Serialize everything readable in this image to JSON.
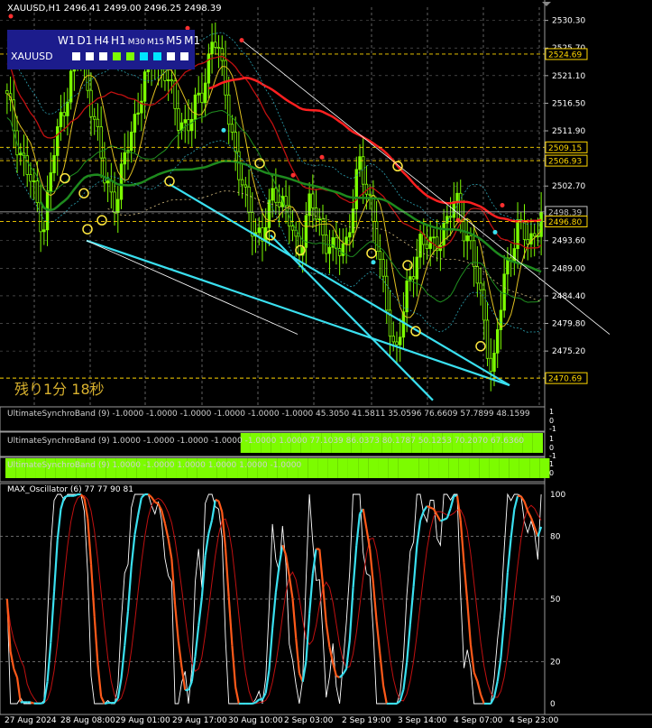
{
  "header": {
    "symbol_tf": "XAUUSD,H1",
    "ohlc": "2496.41 2499.00 2496.25 2498.39"
  },
  "timeframe_panel": {
    "timeframes": [
      "W1",
      "D1",
      "H4",
      "H1",
      "M30",
      "M15",
      "M5",
      "M1"
    ],
    "symbol": "XAUUSD",
    "squares": [
      "#ffffff",
      "#ffffff",
      "#ffffff",
      "#7cfc00",
      "#7cfc00",
      "#00e5ff",
      "#00e5ff",
      "#ffffff",
      "#ffffff"
    ]
  },
  "countdown": "残り1分 18秒",
  "indicators": {
    "band1": "UltimateSynchroBand (9) -1.0000 -1.0000 -1.0000 -1.0000 -1.0000 -1.0000 45.3050 41.5811 35.0596 76.6609 57.7899 48.1599",
    "band2": "UltimateSynchroBand (9) 1.0000 -1.0000 -1.0000 -1.0000 -1.0000 1.0000 77.1039 86.0373 80.1787 50.1253 70.2070 67.6360",
    "band3": "UltimateSynchroBand (9) 1.0000 -1.0000 1.0000 1.0000 1.0000 -1.0000",
    "oscillator": "MAX_Oscillator (6) 77 77 90 81"
  },
  "chart_data": {
    "type": "candlestick",
    "symbol": "XAUUSD",
    "timeframe": "H1",
    "ylim": [
      2466.5,
      2532.5
    ],
    "price_ticks": [
      2530.3,
      2525.7,
      2521.1,
      2516.5,
      2511.9,
      2507.25,
      2502.7,
      2498.1,
      2493.6,
      2489.0,
      2484.4,
      2479.8,
      2475.2
    ],
    "price_tags": [
      {
        "price": 2524.69,
        "label": "2524.69",
        "color": "#ffd700"
      },
      {
        "price": 2509.15,
        "label": "2509.15",
        "color": "#ffd700"
      },
      {
        "price": 2506.93,
        "label": "2506.93",
        "color": "#ffd700"
      },
      {
        "price": 2498.39,
        "label": "2498.39",
        "color": "#c0c0c0"
      },
      {
        "price": 2496.8,
        "label": "2496.80",
        "color": "#ffd700"
      },
      {
        "price": 2470.69,
        "label": "2470.69",
        "color": "#ffd700"
      }
    ],
    "x_labels": [
      "27 Aug 2024",
      "28 Aug 08:00",
      "29 Aug 01:00",
      "29 Aug 17:00",
      "30 Aug 10:00",
      "2 Sep 03:00",
      "2 Sep 19:00",
      "3 Sep 14:00",
      "4 Sep 07:00",
      "4 Sep 23:00"
    ],
    "close_path": [
      2517,
      2509,
      2503,
      2496,
      2510,
      2519,
      2526,
      2516,
      2504,
      2500,
      2510,
      2518,
      2524,
      2522,
      2514,
      2513,
      2518,
      2528,
      2519,
      2505,
      2498,
      2493,
      2503,
      2498,
      2492,
      2500,
      2495,
      2491,
      2494,
      2506,
      2500,
      2485,
      2475,
      2485,
      2494,
      2492,
      2496,
      2500,
      2494,
      2484,
      2471,
      2488,
      2496,
      2493,
      2498
    ],
    "oscillator": {
      "ylim": [
        0,
        100
      ],
      "ticks": [
        100,
        80,
        50,
        20,
        0
      ],
      "values": [
        77,
        77,
        90,
        81
      ]
    }
  }
}
